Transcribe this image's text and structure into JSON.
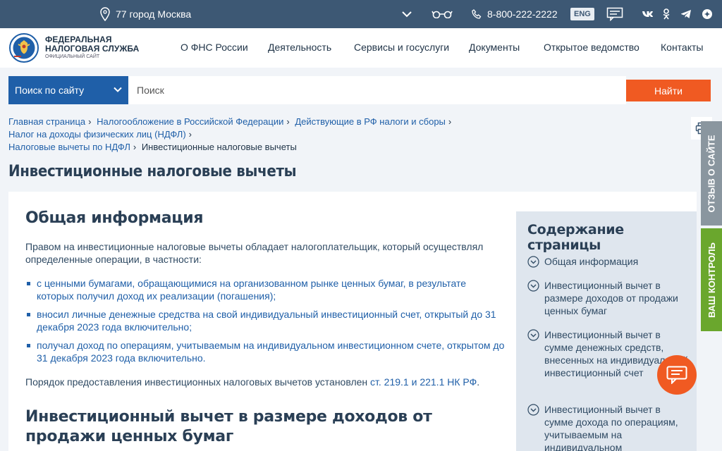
{
  "topbar": {
    "location": "77 город Москва",
    "phone": "8-800-222-2222",
    "lang": "ENG",
    "icons": [
      "chevron-down-icon",
      "glasses-icon",
      "phone-icon",
      "feedback-icon",
      "vk-icon",
      "ok-icon",
      "telegram-icon",
      "dzen-icon"
    ]
  },
  "logo": {
    "line1": "ФЕДЕРАЛЬНАЯ",
    "line2": "НАЛОГОВАЯ СЛУЖБА",
    "line3": "ОФИЦИАЛЬНЫЙ САЙТ"
  },
  "nav": [
    "О ФНС России",
    "Деятельность",
    "Сервисы и госуслуги",
    "Документы",
    "Открытое ведомство",
    "Контакты"
  ],
  "search": {
    "scope": "Поиск по сайту",
    "placeholder": "Поиск",
    "button": "Найти"
  },
  "breadcrumbs": [
    "Главная страница",
    "Налогообложение в Российской Федерации",
    "Действующие в РФ налоги и сборы",
    "Налог на доходы физических лиц (НДФЛ)",
    "Налоговые вычеты по НДФЛ",
    "Инвестиционные налоговые вычеты"
  ],
  "page_title": "Инвестиционные налоговые вычеты",
  "content": {
    "section1_title": "Общая информация",
    "intro": "Правом на инвестиционные налоговые вычеты обладает налогоплательщик, который осуществлял определенные операции, в частности:",
    "items": [
      "с ценными бумагами, обращающимися на организованном рынке ценных бумаг, в результате которых получил доход их реализации (погашения);",
      "вносил личные денежные средства на свой индивидуальный инвестиционный счет, открытый до 31 декабря 2023 года включительно;",
      "получал доход по операциям, учитываемым на индивидуальном инвестиционном счете, открытом до 31 декабря 2023 года включительно."
    ],
    "order_text": "Порядок предоставления инвестиционных налоговых вычетов установлен",
    "order_link": "ст. 219.1 и 221.1 НК РФ",
    "order_end": ".",
    "section2_title": "Инвестиционный вычет в размере доходов от продажи ценных бумаг"
  },
  "toc": {
    "title": "Содержание страницы",
    "items": [
      "Общая информация",
      "Инвестиционный вычет в размере доходов от продажи ценных бумаг",
      "Инвестиционный вычет в сумме денежных средств, внесенных на индивидуальный инвестиционный счет",
      "Инвестиционный вычет в сумме дохода по операциям, учитываемым на индивидуальном"
    ]
  },
  "side_tabs": {
    "feedback": "ОТЗЫВ О САЙТЕ",
    "control": "ВАШ КОНТРОЛЬ"
  },
  "colors": {
    "topbar": "#3d5874",
    "primary": "#1f5fa8",
    "accent": "#f05a22",
    "feedback_tab": "#8a969f",
    "control_tab": "#6aa72d"
  }
}
